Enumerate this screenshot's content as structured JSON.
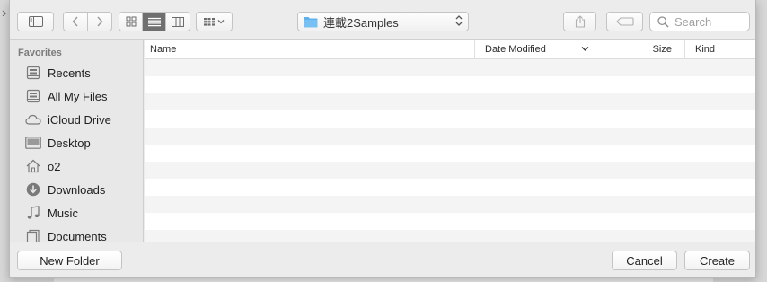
{
  "toolbar": {
    "path_folder": "連載2Samples",
    "search_placeholder": "Search"
  },
  "sidebar": {
    "title": "Favorites",
    "items": [
      {
        "label": "Recents",
        "icon": "recents-icon"
      },
      {
        "label": "All My Files",
        "icon": "all-files-icon"
      },
      {
        "label": "iCloud Drive",
        "icon": "cloud-icon"
      },
      {
        "label": "Desktop",
        "icon": "desktop-icon"
      },
      {
        "label": "o2",
        "icon": "home-icon"
      },
      {
        "label": "Downloads",
        "icon": "download-icon"
      },
      {
        "label": "Music",
        "icon": "music-icon"
      },
      {
        "label": "Documents",
        "icon": "documents-icon"
      }
    ]
  },
  "filelist": {
    "columns": {
      "name": "Name",
      "date": "Date Modified",
      "size": "Size",
      "kind": "Kind"
    }
  },
  "footer": {
    "new_folder": "New Folder",
    "cancel": "Cancel",
    "create": "Create"
  }
}
